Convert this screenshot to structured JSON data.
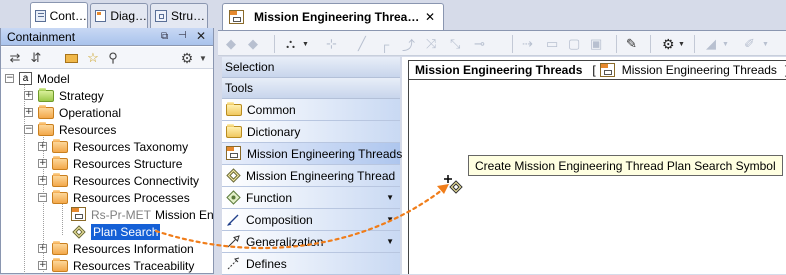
{
  "left_tabs": [
    {
      "label": "Cont…",
      "icon": "containment-tab-icon"
    },
    {
      "label": "Diag…",
      "icon": "diagrams-tab-icon"
    },
    {
      "label": "Stru…",
      "icon": "structure-tab-icon"
    }
  ],
  "containment": {
    "title": "Containment",
    "tree": [
      {
        "label": "Model",
        "type": "model"
      },
      {
        "label": "Strategy",
        "type": "folder-green"
      },
      {
        "label": "Operational",
        "type": "folder-orange"
      },
      {
        "label": "Resources",
        "type": "folder-orange"
      },
      {
        "label": "Resources Taxonomy",
        "type": "folder-orange"
      },
      {
        "label": "Resources Structure",
        "type": "folder-orange"
      },
      {
        "label": "Resources Connectivity",
        "type": "folder-orange"
      },
      {
        "label": "Resources Processes",
        "type": "folder-orange"
      },
      {
        "label": "Rs-Pr-MET Mission Eng",
        "prefix": "Rs-Pr-MET",
        "name": "Mission Eng",
        "type": "diagram"
      },
      {
        "label": "Plan Search",
        "type": "symbol",
        "selected": true
      },
      {
        "label": "Resources Information",
        "type": "folder-orange"
      },
      {
        "label": "Resources Traceability",
        "type": "folder-orange"
      }
    ]
  },
  "editor": {
    "tab_title": "Mission Engineering Threa…",
    "close_glyph": "✕"
  },
  "palette": {
    "categories": [
      "Selection",
      "Tools"
    ],
    "items": [
      {
        "label": "Common",
        "icon": "folder-icon"
      },
      {
        "label": "Dictionary",
        "icon": "folder-icon"
      },
      {
        "label": "Mission Engineering Threads",
        "icon": "diagram-icon",
        "highlighted": true
      },
      {
        "label": "Mission Engineering Thread",
        "icon": "thread-symbol-icon"
      },
      {
        "label": "Function",
        "icon": "function-icon",
        "submenu": true
      },
      {
        "label": "Composition",
        "icon": "composition-icon",
        "submenu": true
      },
      {
        "label": "Generalization",
        "icon": "generalization-icon",
        "submenu": true
      },
      {
        "label": "Defines",
        "icon": "defines-icon"
      }
    ]
  },
  "diagram": {
    "frame_label": "Mission Engineering Threads",
    "frame_ref": "Mission Engineering Threads",
    "tooltip": "Create Mission Engineering Thread Plan Search Symbol"
  },
  "colors": {
    "accent_arrow": "#f07d1a",
    "selection": "#1560d6",
    "panel_header": "#b9cef0"
  }
}
